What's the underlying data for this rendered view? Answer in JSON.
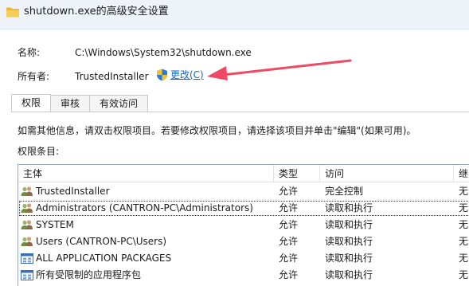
{
  "window": {
    "title": "shutdown.exe的高级安全设置"
  },
  "name_field": {
    "label": "名称:",
    "value": "C:\\Windows\\System32\\shutdown.exe"
  },
  "owner_field": {
    "label": "所有者:",
    "value": "TrustedInstaller",
    "change_label": "更改(C)"
  },
  "tabs": [
    {
      "label": "权限",
      "active": true
    },
    {
      "label": "审核",
      "active": false
    },
    {
      "label": "有效访问",
      "active": false
    }
  ],
  "info_text": "如需其他信息，请双击权限项目。若要修改权限项目，请选择该项目并单击\"编辑\"(如果可用)。",
  "entries_heading": "权限条目:",
  "table": {
    "headers": {
      "principal": "主体",
      "type": "类型",
      "access": "访问",
      "inherited": "继"
    },
    "rows": [
      {
        "principal": "TrustedInstaller",
        "type": "允许",
        "access": "完全控制",
        "inherited": "无",
        "icon": "users-icon"
      },
      {
        "principal": "Administrators (CANTRON-PC\\Administrators)",
        "type": "允许",
        "access": "读取和执行",
        "inherited": "无",
        "icon": "users-icon",
        "selected": true
      },
      {
        "principal": "SYSTEM",
        "type": "允许",
        "access": "读取和执行",
        "inherited": "无",
        "icon": "users-icon"
      },
      {
        "principal": "Users (CANTRON-PC\\Users)",
        "type": "允许",
        "access": "读取和执行",
        "inherited": "无",
        "icon": "users-icon"
      },
      {
        "principal": "ALL APPLICATION PACKAGES",
        "type": "允许",
        "access": "读取和执行",
        "inherited": "无",
        "icon": "app-package-icon"
      },
      {
        "principal": "所有受限制的应用程序包",
        "type": "允许",
        "access": "读取和执行",
        "inherited": "无",
        "icon": "app-package-icon"
      }
    ]
  },
  "colors": {
    "link": "#1565c0",
    "arrow": "#ef4a63",
    "titlebar": "#eef3fa"
  }
}
